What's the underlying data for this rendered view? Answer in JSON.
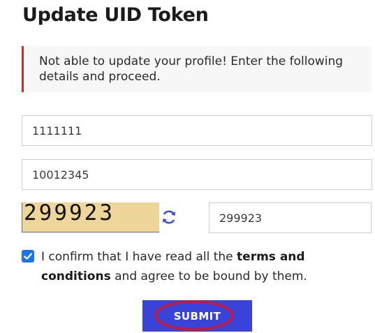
{
  "page": {
    "title": "Update UID Token"
  },
  "alert": {
    "message": "Not able to update your profile! Enter the following details and proceed.",
    "accent_color": "#cc2b2b"
  },
  "form": {
    "uid_value": "1111111",
    "token_value": "10012345",
    "captcha_image_text": "299923",
    "captcha_value": "299923",
    "refresh_icon": "refresh-icon",
    "confirm_checked": true,
    "confirm_text_1": "I confirm that I have read all the ",
    "confirm_terms": "terms and conditions",
    "confirm_text_2": " and agree to be bound by them.",
    "submit_label": "SUBMIT",
    "submit_color": "#3a43d9",
    "highlight_color": "#e3101a"
  }
}
